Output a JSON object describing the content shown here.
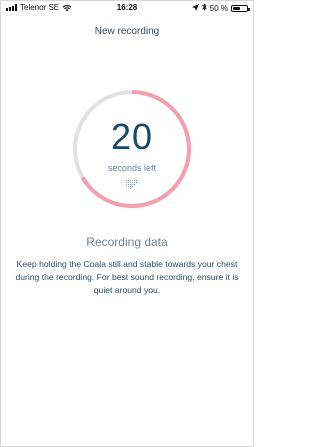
{
  "status_bar": {
    "carrier": "Telenor SE",
    "time": "16:28",
    "battery": "50 %",
    "battery_level": 0.5,
    "icons": [
      "signal-icon",
      "wifi-icon",
      "location-arrow-icon",
      "bluetooth-icon",
      "battery-icon"
    ]
  },
  "header": {
    "title": "New recording"
  },
  "timer": {
    "count": "20",
    "label": "seconds left",
    "progress_fraction_remaining": 0.6667,
    "colors": {
      "track": "#e2e2e2",
      "progress": "#f2a0ad",
      "count_text": "#1b4a66"
    }
  },
  "recording": {
    "title": "Recording data",
    "instructions": "Keep holding the Coala still and stable towards your chest during the recording. For best sound recording, ensure it is quiet around you."
  }
}
